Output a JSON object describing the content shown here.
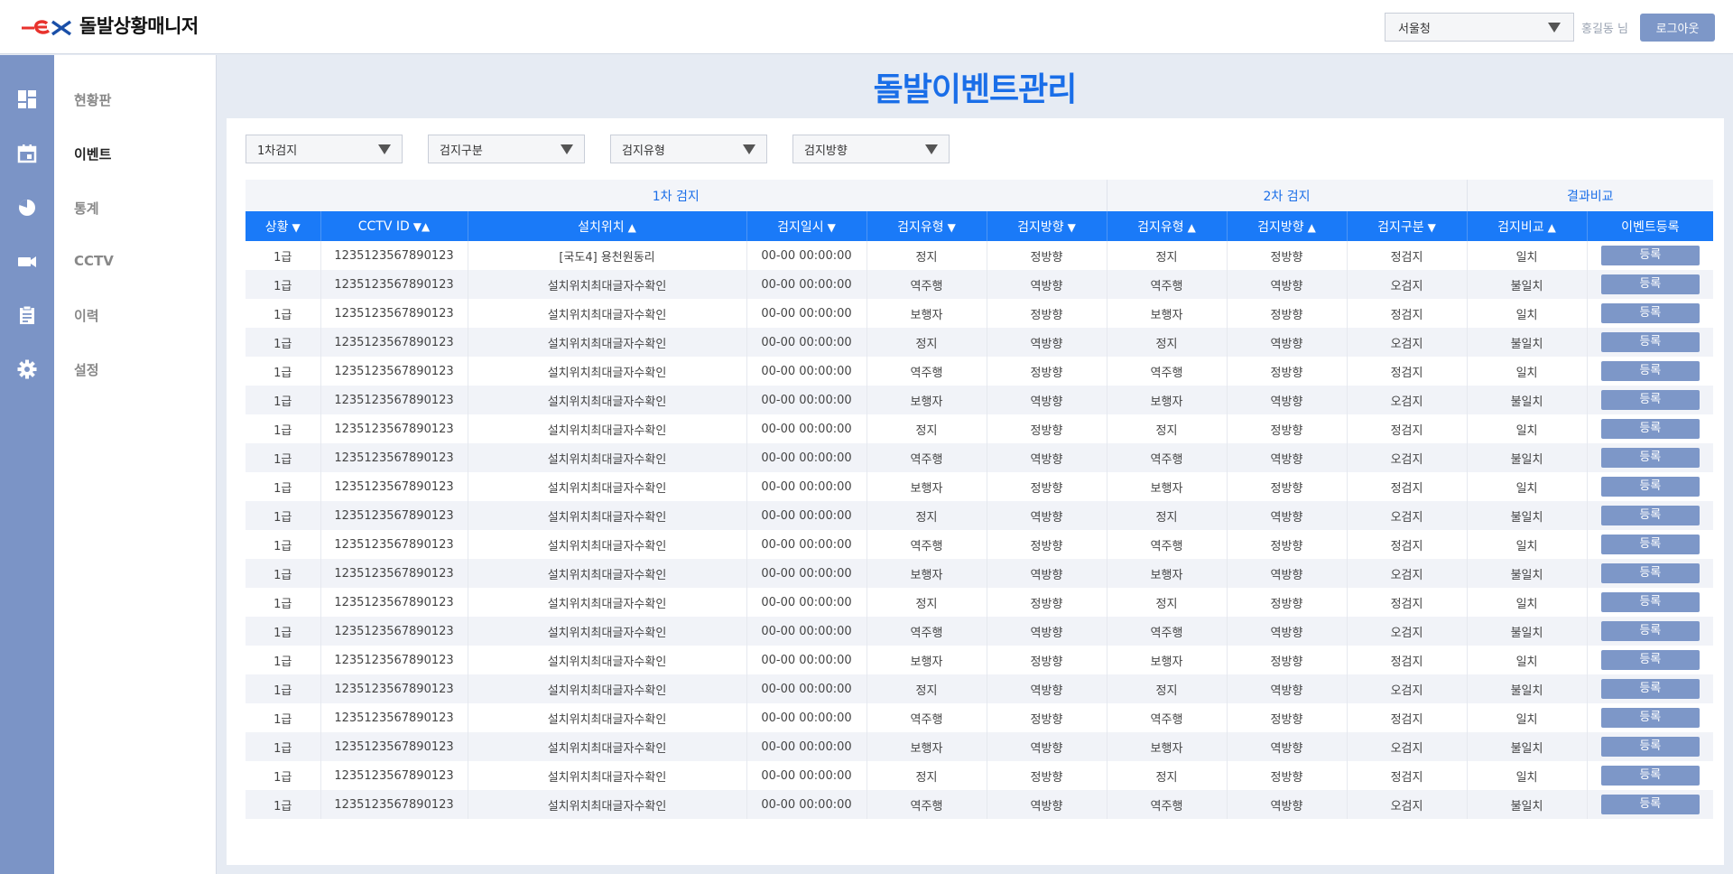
{
  "header": {
    "app_title": "돌발상황매니저",
    "region_select": "서울청",
    "user_name": "홍길동 님",
    "logout_label": "로그아웃"
  },
  "rail_icons": [
    "dashboard-icon",
    "calendar-icon",
    "pie-chart-icon",
    "video-camera-icon",
    "clipboard-icon",
    "gear-icon"
  ],
  "sidebar": {
    "items": [
      {
        "label": "현황판",
        "active": false
      },
      {
        "label": "이벤트",
        "active": true
      },
      {
        "label": "통계",
        "active": false
      },
      {
        "label": "CCTV",
        "active": false
      },
      {
        "label": "이력",
        "active": false
      },
      {
        "label": "설정",
        "active": false
      }
    ]
  },
  "page_title": "돌발이벤트관리",
  "filters": [
    "1차검지",
    "검지구분",
    "검지유형",
    "검지방향"
  ],
  "table": {
    "groups": {
      "first": "1차 검지",
      "second": "2차 검지",
      "result": "결과비교"
    },
    "columns": [
      {
        "label": "상황",
        "sort": "▼"
      },
      {
        "label": "CCTV ID",
        "sort": "▼▲"
      },
      {
        "label": "설치위치",
        "sort": "▲"
      },
      {
        "label": "검지일시",
        "sort": "▼"
      },
      {
        "label": "검지유형",
        "sort": "▼"
      },
      {
        "label": "검지방향",
        "sort": "▼"
      },
      {
        "label": "검지유형",
        "sort": "▲"
      },
      {
        "label": "검지방향",
        "sort": "▲"
      },
      {
        "label": "검지구분",
        "sort": "▼"
      },
      {
        "label": "검지비교",
        "sort": "▲"
      },
      {
        "label": "이벤트등록",
        "sort": ""
      }
    ],
    "register_label": "등록",
    "rows": [
      [
        "1급",
        "1235123567890123",
        "[국도4] 용천원동리",
        "00-00 00:00:00",
        "정지",
        "정방향",
        "정지",
        "정방향",
        "정검지",
        "일치"
      ],
      [
        "1급",
        "1235123567890123",
        "설치위치최대글자수확인",
        "00-00 00:00:00",
        "역주행",
        "역방향",
        "역주행",
        "역방향",
        "오검지",
        "불일치"
      ],
      [
        "1급",
        "1235123567890123",
        "설치위치최대글자수확인",
        "00-00 00:00:00",
        "보행자",
        "정방향",
        "보행자",
        "정방향",
        "정검지",
        "일치"
      ],
      [
        "1급",
        "1235123567890123",
        "설치위치최대글자수확인",
        "00-00 00:00:00",
        "정지",
        "역방향",
        "정지",
        "역방향",
        "오검지",
        "불일치"
      ],
      [
        "1급",
        "1235123567890123",
        "설치위치최대글자수확인",
        "00-00 00:00:00",
        "역주행",
        "정방향",
        "역주행",
        "정방향",
        "정검지",
        "일치"
      ],
      [
        "1급",
        "1235123567890123",
        "설치위치최대글자수확인",
        "00-00 00:00:00",
        "보행자",
        "역방향",
        "보행자",
        "역방향",
        "오검지",
        "불일치"
      ],
      [
        "1급",
        "1235123567890123",
        "설치위치최대글자수확인",
        "00-00 00:00:00",
        "정지",
        "정방향",
        "정지",
        "정방향",
        "정검지",
        "일치"
      ],
      [
        "1급",
        "1235123567890123",
        "설치위치최대글자수확인",
        "00-00 00:00:00",
        "역주행",
        "역방향",
        "역주행",
        "역방향",
        "오검지",
        "불일치"
      ],
      [
        "1급",
        "1235123567890123",
        "설치위치최대글자수확인",
        "00-00 00:00:00",
        "보행자",
        "정방향",
        "보행자",
        "정방향",
        "정검지",
        "일치"
      ],
      [
        "1급",
        "1235123567890123",
        "설치위치최대글자수확인",
        "00-00 00:00:00",
        "정지",
        "역방향",
        "정지",
        "역방향",
        "오검지",
        "불일치"
      ],
      [
        "1급",
        "1235123567890123",
        "설치위치최대글자수확인",
        "00-00 00:00:00",
        "역주행",
        "정방향",
        "역주행",
        "정방향",
        "정검지",
        "일치"
      ],
      [
        "1급",
        "1235123567890123",
        "설치위치최대글자수확인",
        "00-00 00:00:00",
        "보행자",
        "역방향",
        "보행자",
        "역방향",
        "오검지",
        "불일치"
      ],
      [
        "1급",
        "1235123567890123",
        "설치위치최대글자수확인",
        "00-00 00:00:00",
        "정지",
        "정방향",
        "정지",
        "정방향",
        "정검지",
        "일치"
      ],
      [
        "1급",
        "1235123567890123",
        "설치위치최대글자수확인",
        "00-00 00:00:00",
        "역주행",
        "역방향",
        "역주행",
        "역방향",
        "오검지",
        "불일치"
      ],
      [
        "1급",
        "1235123567890123",
        "설치위치최대글자수확인",
        "00-00 00:00:00",
        "보행자",
        "정방향",
        "보행자",
        "정방향",
        "정검지",
        "일치"
      ],
      [
        "1급",
        "1235123567890123",
        "설치위치최대글자수확인",
        "00-00 00:00:00",
        "정지",
        "역방향",
        "정지",
        "역방향",
        "오검지",
        "불일치"
      ],
      [
        "1급",
        "1235123567890123",
        "설치위치최대글자수확인",
        "00-00 00:00:00",
        "역주행",
        "정방향",
        "역주행",
        "정방향",
        "정검지",
        "일치"
      ],
      [
        "1급",
        "1235123567890123",
        "설치위치최대글자수확인",
        "00-00 00:00:00",
        "보행자",
        "역방향",
        "보행자",
        "역방향",
        "오검지",
        "불일치"
      ],
      [
        "1급",
        "1235123567890123",
        "설치위치최대글자수확인",
        "00-00 00:00:00",
        "정지",
        "정방향",
        "정지",
        "정방향",
        "정검지",
        "일치"
      ],
      [
        "1급",
        "1235123567890123",
        "설치위치최대글자수확인",
        "00-00 00:00:00",
        "역주행",
        "역방향",
        "역주행",
        "역방향",
        "오검지",
        "불일치"
      ]
    ]
  },
  "colors": {
    "accent": "#1a7af8",
    "rail": "#7b94c6",
    "button": "#7d97c8",
    "mismatch": "#e83a2c"
  }
}
